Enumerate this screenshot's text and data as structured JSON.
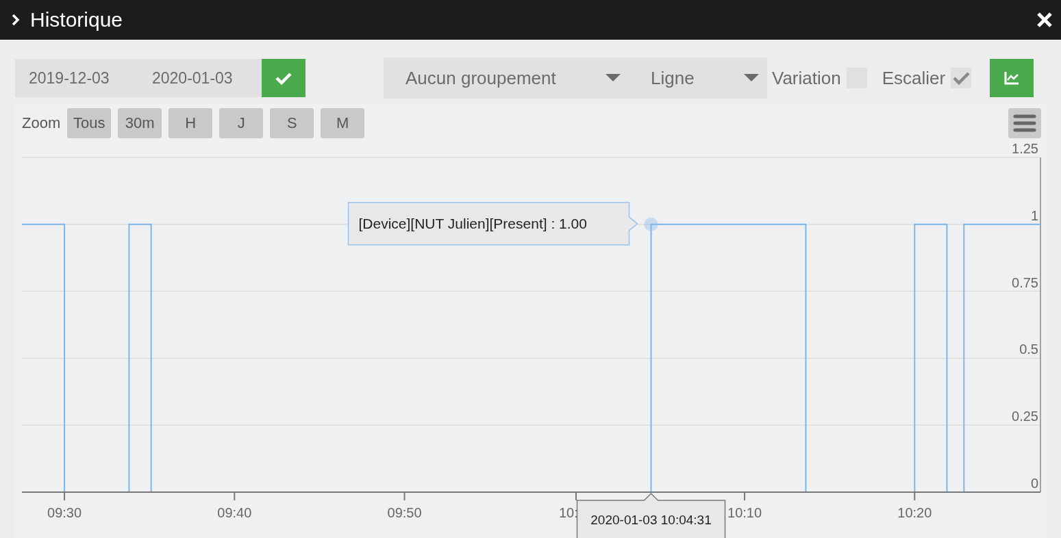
{
  "window": {
    "title": "Historique"
  },
  "filters": {
    "start_date": "2019-12-03",
    "end_date": "2020-01-03",
    "grouping": "Aucun groupement",
    "chart_type": "Ligne",
    "options": [
      {
        "label": "Variation",
        "checked": false
      },
      {
        "label": "Escalier",
        "checked": true
      }
    ]
  },
  "zoom": {
    "label": "Zoom",
    "buttons": [
      {
        "label": "Tous"
      },
      {
        "label": "30m"
      },
      {
        "label": "H"
      },
      {
        "label": "J"
      },
      {
        "label": "S"
      },
      {
        "label": "M"
      }
    ]
  },
  "chart": {
    "chart_data": {
      "type": "line",
      "x": [
        567.5,
        570,
        570,
        573.8,
        573.8,
        575.1,
        575.1,
        604.5,
        604.5,
        613.6,
        613.6,
        620,
        620,
        621.9,
        621.9,
        622.9,
        622.9,
        627.4
      ],
      "series": [
        {
          "color": "#7cb5ec",
          "values": [
            1,
            1,
            0,
            0,
            1,
            1,
            0,
            0,
            1,
            1,
            0,
            0,
            1,
            1,
            0,
            0,
            1,
            1
          ]
        }
      ],
      "xlim": [
        567.5,
        627.4
      ],
      "ylim": [
        0,
        1.25
      ],
      "grid": true,
      "xticks": [
        {
          "value": 570,
          "label": "09:30"
        },
        {
          "value": 580,
          "label": "09:40"
        },
        {
          "value": 590,
          "label": "09:50"
        },
        {
          "value": 610,
          "label": "10:10"
        },
        {
          "value": 620,
          "label": "10:20"
        }
      ],
      "yticks": [
        0,
        0.25,
        0.5,
        0.75,
        1,
        1.25
      ]
    },
    "partial_tick_label": "10:",
    "tooltip": "[Device][NUT Julien][Present] : 1.00",
    "crosshair_label": "2020-01-03 10:04:31"
  }
}
